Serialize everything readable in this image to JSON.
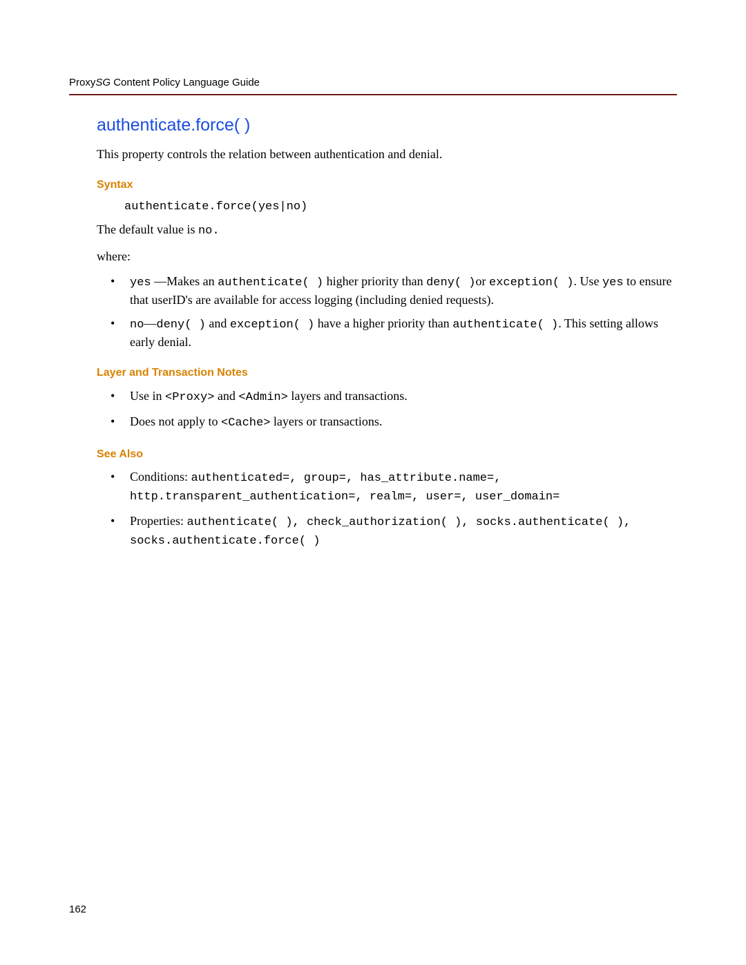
{
  "header": {
    "proxy": "Proxy",
    "sg": "SG",
    "rest": " Content Policy Language Guide"
  },
  "title": "authenticate.force( )",
  "intro": "This property controls the relation between authentication and denial.",
  "syntax": {
    "heading": "Syntax",
    "code": "authenticate.force(yes|no)",
    "default_pre": "The default value is ",
    "default_code": "no.",
    "where": "where:",
    "items": {
      "yes": {
        "c1": "yes",
        "t1": " —Makes an ",
        "c2": "authenticate( )",
        "t2": " higher priority than ",
        "c3": "deny( )",
        "t3": "or ",
        "c4": "exception( )",
        "t4": ". Use ",
        "c5": "yes",
        "t5": " to ensure that userID's are available for access logging (including denied requests)."
      },
      "no": {
        "c1": "no",
        "t1": "—",
        "c2": "deny( )",
        "t2": " and ",
        "c3": "exception( )",
        "t3": " have a higher priority than ",
        "c4": "authenticate( )",
        "t4": ". This setting allows early denial."
      }
    }
  },
  "layer": {
    "heading": "Layer and Transaction Notes",
    "item1": {
      "t1": "Use in ",
      "c1": "<Proxy>",
      "t2": " and ",
      "c2": "<Admin>",
      "t3": " layers and transactions."
    },
    "item2": {
      "t1": "Does not apply to ",
      "c1": "<Cache>",
      "t2": " layers or transactions."
    }
  },
  "seealso": {
    "heading": "See Also",
    "cond": {
      "t1": "Conditions: ",
      "c1": "authenticated=",
      "s1": ", ",
      "c2": "group=",
      "s2": ", ",
      "c3": "has_attribute.name=",
      "s3": ", ",
      "c4": "http.transparent_authentication=",
      "s4": ", ",
      "c5": "realm=",
      "s5": ", ",
      "c6": "user=",
      "s6": ", ",
      "c7": "user_domain="
    },
    "prop": {
      "t1": "Properties: ",
      "c1": "authenticate( )",
      "s1": ", ",
      "c2": "check_authorization( )",
      "s2": ", ",
      "c3": "socks.authenticate( )",
      "s3": ", ",
      "c4": "socks.authenticate.force( )"
    }
  },
  "page_number": "162"
}
